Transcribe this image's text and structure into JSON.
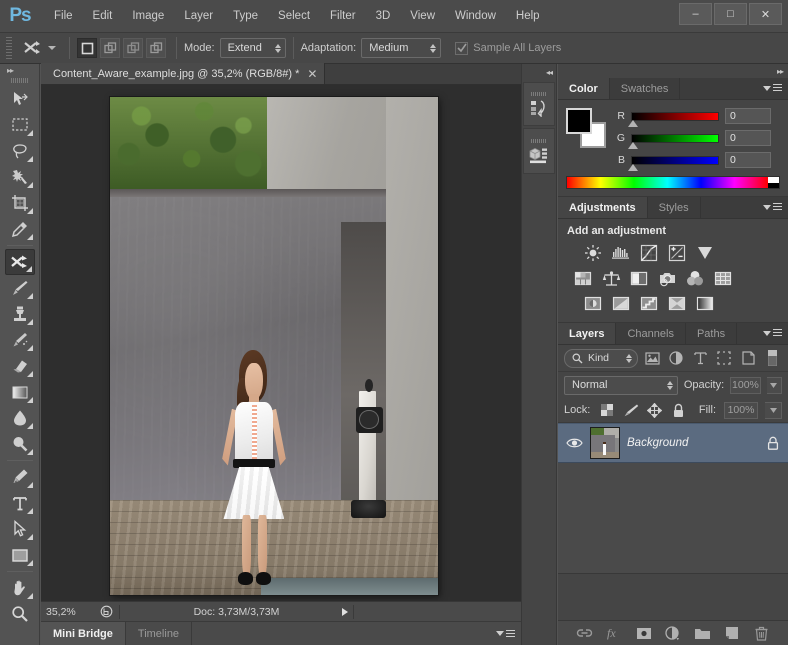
{
  "app": {
    "logo": "Ps"
  },
  "menubar": {
    "items": [
      "File",
      "Edit",
      "Image",
      "Layer",
      "Type",
      "Select",
      "Filter",
      "3D",
      "View",
      "Window",
      "Help"
    ]
  },
  "window_controls": {
    "minimize": "–",
    "maximize": "□",
    "close": "✕"
  },
  "options_bar": {
    "mode_label": "Mode:",
    "mode_value": "Extend",
    "adaptation_label": "Adaptation:",
    "adaptation_value": "Medium",
    "sample_all_layers_label": "Sample All Layers",
    "sample_all_layers_checked": true,
    "selection_modes": [
      "new-selection",
      "add-to-selection",
      "subtract-from-selection",
      "intersect-with-selection"
    ]
  },
  "toolbar": {
    "tools": [
      {
        "name": "move-tool",
        "selected": false,
        "has_flyout": false
      },
      {
        "name": "rectangular-marquee-tool",
        "selected": false,
        "has_flyout": true
      },
      {
        "name": "lasso-tool",
        "selected": false,
        "has_flyout": true
      },
      {
        "name": "quick-selection-tool",
        "selected": false,
        "has_flyout": true
      },
      {
        "name": "crop-tool",
        "selected": false,
        "has_flyout": true
      },
      {
        "name": "eyedropper-tool",
        "selected": false,
        "has_flyout": true
      },
      {
        "name": "content-aware-move-tool",
        "selected": true,
        "has_flyout": true
      },
      {
        "name": "brush-tool",
        "selected": false,
        "has_flyout": true
      },
      {
        "name": "clone-stamp-tool",
        "selected": false,
        "has_flyout": true
      },
      {
        "name": "history-brush-tool",
        "selected": false,
        "has_flyout": true
      },
      {
        "name": "eraser-tool",
        "selected": false,
        "has_flyout": true
      },
      {
        "name": "gradient-tool",
        "selected": false,
        "has_flyout": true
      },
      {
        "name": "blur-tool",
        "selected": false,
        "has_flyout": true
      },
      {
        "name": "dodge-tool",
        "selected": false,
        "has_flyout": true
      },
      {
        "name": "pen-tool",
        "selected": false,
        "has_flyout": true
      },
      {
        "name": "type-tool",
        "selected": false,
        "has_flyout": true
      },
      {
        "name": "path-selection-tool",
        "selected": false,
        "has_flyout": true
      },
      {
        "name": "rectangle-tool",
        "selected": false,
        "has_flyout": true
      },
      {
        "name": "hand-tool",
        "selected": false,
        "has_flyout": true
      },
      {
        "name": "zoom-tool",
        "selected": false,
        "has_flyout": false
      }
    ]
  },
  "document": {
    "tab_title": "Content_Aware_example.jpg @ 35,2% (RGB/8#) *",
    "close_glyph": "✕"
  },
  "status_bar": {
    "zoom": "35,2%",
    "doc_info": "Doc: 3,73M/3,73M"
  },
  "bottom_tabs": {
    "items": [
      {
        "label": "Mini Bridge",
        "active": true
      },
      {
        "label": "Timeline",
        "active": false
      }
    ]
  },
  "mini_dock": {
    "collapse_glyph": "◂◂",
    "buttons": [
      "history-panel-icon",
      "properties-panel-icon"
    ]
  },
  "dock": {
    "collapse_glyph": "▸▸"
  },
  "color_panel": {
    "tabs": [
      {
        "label": "Color",
        "active": true
      },
      {
        "label": "Swatches",
        "active": false
      }
    ],
    "foreground_color": "#000000",
    "background_color": "#ffffff",
    "channels": [
      {
        "label": "R",
        "value": "0"
      },
      {
        "label": "G",
        "value": "0"
      },
      {
        "label": "B",
        "value": "0"
      }
    ]
  },
  "adjustments_panel": {
    "tabs": [
      {
        "label": "Adjustments",
        "active": true
      },
      {
        "label": "Styles",
        "active": false
      }
    ],
    "title": "Add an adjustment",
    "rows": [
      [
        "brightness-contrast-icon",
        "levels-icon",
        "curves-icon",
        "exposure-icon",
        "vibrance-icon"
      ],
      [
        "hue-saturation-icon",
        "color-balance-icon",
        "black-white-icon",
        "photo-filter-icon",
        "channel-mixer-icon",
        "color-lookup-icon"
      ],
      [
        "invert-icon",
        "posterize-icon",
        "threshold-icon",
        "selective-color-icon",
        "gradient-map-icon"
      ]
    ]
  },
  "layers_panel": {
    "tabs": [
      {
        "label": "Layers",
        "active": true
      },
      {
        "label": "Channels",
        "active": false
      },
      {
        "label": "Paths",
        "active": false
      }
    ],
    "filter_kind": "Kind",
    "filter_icons": [
      "filter-pixel-icon",
      "filter-adjustment-icon",
      "filter-type-icon",
      "filter-shape-icon",
      "filter-smart-object-icon"
    ],
    "blend_mode": "Normal",
    "opacity_label": "Opacity:",
    "opacity_value": "100%",
    "lock_label": "Lock:",
    "lock_icons": [
      "lock-transparent-pixels-icon",
      "lock-image-pixels-icon",
      "lock-position-icon",
      "lock-all-icon"
    ],
    "fill_label": "Fill:",
    "fill_value": "100%",
    "layers": [
      {
        "name": "Background",
        "visible": true,
        "locked": true,
        "selected": true
      }
    ],
    "footer_icons": [
      "link-layers-icon",
      "layer-style-fx-icon",
      "add-layer-mask-icon",
      "new-adjustment-layer-icon",
      "new-group-icon",
      "new-layer-icon",
      "delete-layer-icon"
    ]
  },
  "theme": {
    "panel_bg": "#454545",
    "app_bg": "#535353",
    "canvas_bg": "#2e2e2e",
    "selected_layer": "#5b6b80",
    "logo_blue": "#6fb8e0"
  }
}
